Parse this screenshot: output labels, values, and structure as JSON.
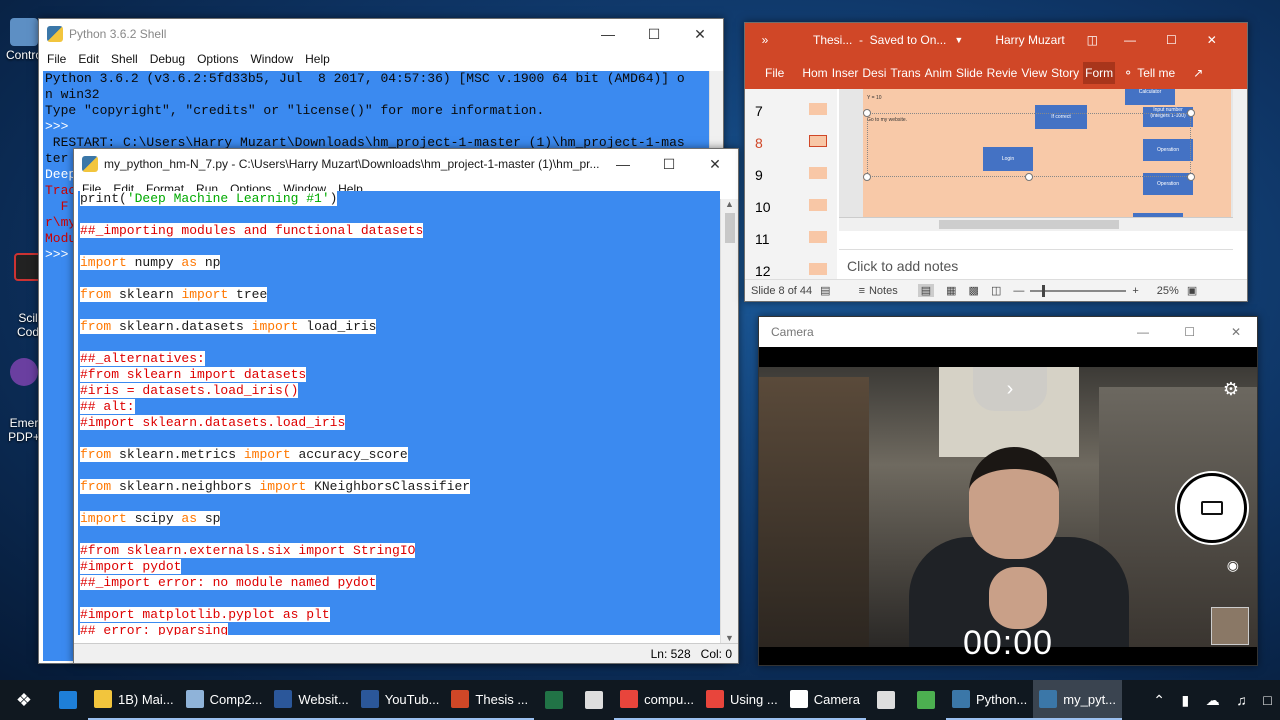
{
  "desktop": {
    "icons": [
      {
        "label": "Contro"
      },
      {
        "label": "Scil\nCod"
      },
      {
        "label": "Emer\nPDP+"
      }
    ]
  },
  "shell": {
    "title": "Python 3.6.2 Shell",
    "menu": [
      "File",
      "Edit",
      "Shell",
      "Debug",
      "Options",
      "Window",
      "Help"
    ],
    "lines": [
      "Python 3.6.2 (v3.6.2:5fd33b5, Jul  8 2017, 04:57:36) [MSC v.1900 64 bit (AMD64)] o",
      "n win32",
      "Type \"copyright\", \"credits\" or \"license()\" for more information.",
      ">>> ",
      " RESTART: C:\\Users\\Harry Muzart\\Downloads\\hm_project-1-master (1)\\hm_project-1-mas",
      "ter",
      "Deep",
      "Trac",
      "  F",
      "r\\my",
      "",
      "Modu",
      ">>> "
    ]
  },
  "editor": {
    "title": "my_python_hm-N_7.py - C:\\Users\\Harry Muzart\\Downloads\\hm_project-1-master (1)\\hm_pr...",
    "menu": [
      "File",
      "Edit",
      "Format",
      "Run",
      "Options",
      "Window",
      "Help"
    ],
    "status": "Ln: 528   Col: 0",
    "code": [
      [
        {
          "t": "print(",
          "c": "plain"
        },
        {
          "t": "'Deep Machine Learning #1'",
          "c": "str"
        },
        {
          "t": ")",
          "c": "plain"
        }
      ],
      [],
      [
        {
          "t": "##_importing modules and functional datasets",
          "c": "comment"
        }
      ],
      [],
      [
        {
          "t": "import",
          "c": "kw"
        },
        {
          "t": " numpy ",
          "c": "plain"
        },
        {
          "t": "as",
          "c": "kw"
        },
        {
          "t": " np",
          "c": "plain"
        }
      ],
      [],
      [
        {
          "t": "from",
          "c": "kw"
        },
        {
          "t": " sklearn ",
          "c": "plain"
        },
        {
          "t": "import",
          "c": "kw"
        },
        {
          "t": " tree",
          "c": "plain"
        }
      ],
      [],
      [
        {
          "t": "from",
          "c": "kw"
        },
        {
          "t": " sklearn.datasets ",
          "c": "plain"
        },
        {
          "t": "import",
          "c": "kw"
        },
        {
          "t": " load_iris",
          "c": "plain"
        }
      ],
      [],
      [
        {
          "t": "##_alternatives:",
          "c": "comment"
        }
      ],
      [
        {
          "t": "#from sklearn import datasets",
          "c": "comment"
        }
      ],
      [
        {
          "t": "#iris = datasets.load_iris()",
          "c": "comment"
        }
      ],
      [
        {
          "t": "## alt:",
          "c": "comment"
        }
      ],
      [
        {
          "t": "#import sklearn.datasets.load_iris",
          "c": "comment"
        }
      ],
      [],
      [
        {
          "t": "from",
          "c": "kw"
        },
        {
          "t": " sklearn.metrics ",
          "c": "plain"
        },
        {
          "t": "import",
          "c": "kw"
        },
        {
          "t": " accuracy_score",
          "c": "plain"
        }
      ],
      [],
      [
        {
          "t": "from",
          "c": "kw"
        },
        {
          "t": " sklearn.neighbors ",
          "c": "plain"
        },
        {
          "t": "import",
          "c": "kw"
        },
        {
          "t": " KNeighborsClassifier",
          "c": "plain"
        }
      ],
      [],
      [
        {
          "t": "import",
          "c": "kw"
        },
        {
          "t": " scipy ",
          "c": "plain"
        },
        {
          "t": "as",
          "c": "kw"
        },
        {
          "t": " sp",
          "c": "plain"
        }
      ],
      [],
      [
        {
          "t": "#from sklearn.externals.six import StringIO",
          "c": "comment"
        }
      ],
      [
        {
          "t": "#import pydot",
          "c": "comment"
        }
      ],
      [
        {
          "t": "##_import error: no module named pydot",
          "c": "comment"
        }
      ],
      [],
      [
        {
          "t": "#import matplotlib.pyplot as plt",
          "c": "comment"
        }
      ],
      [
        {
          "t": "##_error: pyparsing",
          "c": "comment"
        }
      ]
    ]
  },
  "powerpoint": {
    "title": "Thesi...  -  Saved to On...",
    "user": "Harry Muzart",
    "tabs": [
      "File",
      "Hom",
      "Inser",
      "Desi",
      "Trans",
      "Anim",
      "Slide",
      "Revie",
      "View",
      "Story",
      "Form"
    ],
    "tell_me": "Tell me",
    "slide_numbers": [
      "7",
      "8",
      "9",
      "10",
      "11",
      "12"
    ],
    "active_slide": "8",
    "diagram_labels": {
      "calculator": "Calculator",
      "input": "Input number\n(integers 1-100)",
      "if_correct": "If correct",
      "login": "Login",
      "operation1": "Operation",
      "operation2": "Operation",
      "output": "Output = result",
      "website": "Go to my website.",
      "y_label": "Y = 10"
    },
    "notes_placeholder": "Click to add notes",
    "status_slide": "Slide 8 of 44",
    "notes_label": "Notes",
    "zoom": "25%",
    "colors": {
      "accent": "#d04727"
    }
  },
  "camera": {
    "title": "Camera",
    "timer": "00:00"
  },
  "taskbar": {
    "items": [
      {
        "label": "",
        "icon": "windows-start-icon",
        "color": "#ffffff"
      },
      {
        "label": "",
        "icon": "edge-icon",
        "color": "#1e7fd8"
      },
      {
        "label": "1B) Mai...",
        "icon": "folder-icon",
        "color": "#f2c53d"
      },
      {
        "label": "Comp2...",
        "icon": "notepad-icon",
        "color": "#8fb3d9"
      },
      {
        "label": "Websit...",
        "icon": "word-icon",
        "color": "#2b579a"
      },
      {
        "label": "YouTub...",
        "icon": "word-icon",
        "color": "#2b579a"
      },
      {
        "label": "Thesis ...",
        "icon": "powerpoint-icon",
        "color": "#d04727"
      },
      {
        "label": "",
        "icon": "excel-icon",
        "color": "#217346"
      },
      {
        "label": "",
        "icon": "calendar-icon",
        "color": "#dddddd"
      },
      {
        "label": "compu...",
        "icon": "chrome-icon",
        "color": "#e8453c"
      },
      {
        "label": "Using ...",
        "icon": "chrome-icon",
        "color": "#e8453c"
      },
      {
        "label": "Camera",
        "icon": "camera-icon",
        "color": "#ffffff"
      },
      {
        "label": "",
        "icon": "jupyter-icon",
        "color": "#dddddd"
      },
      {
        "label": "",
        "icon": "image-icon",
        "color": "#4caf50"
      },
      {
        "label": "Python...",
        "icon": "python-icon",
        "color": "#3b77a8"
      },
      {
        "label": "my_pyt...",
        "icon": "python-icon",
        "color": "#3b77a8"
      }
    ]
  }
}
